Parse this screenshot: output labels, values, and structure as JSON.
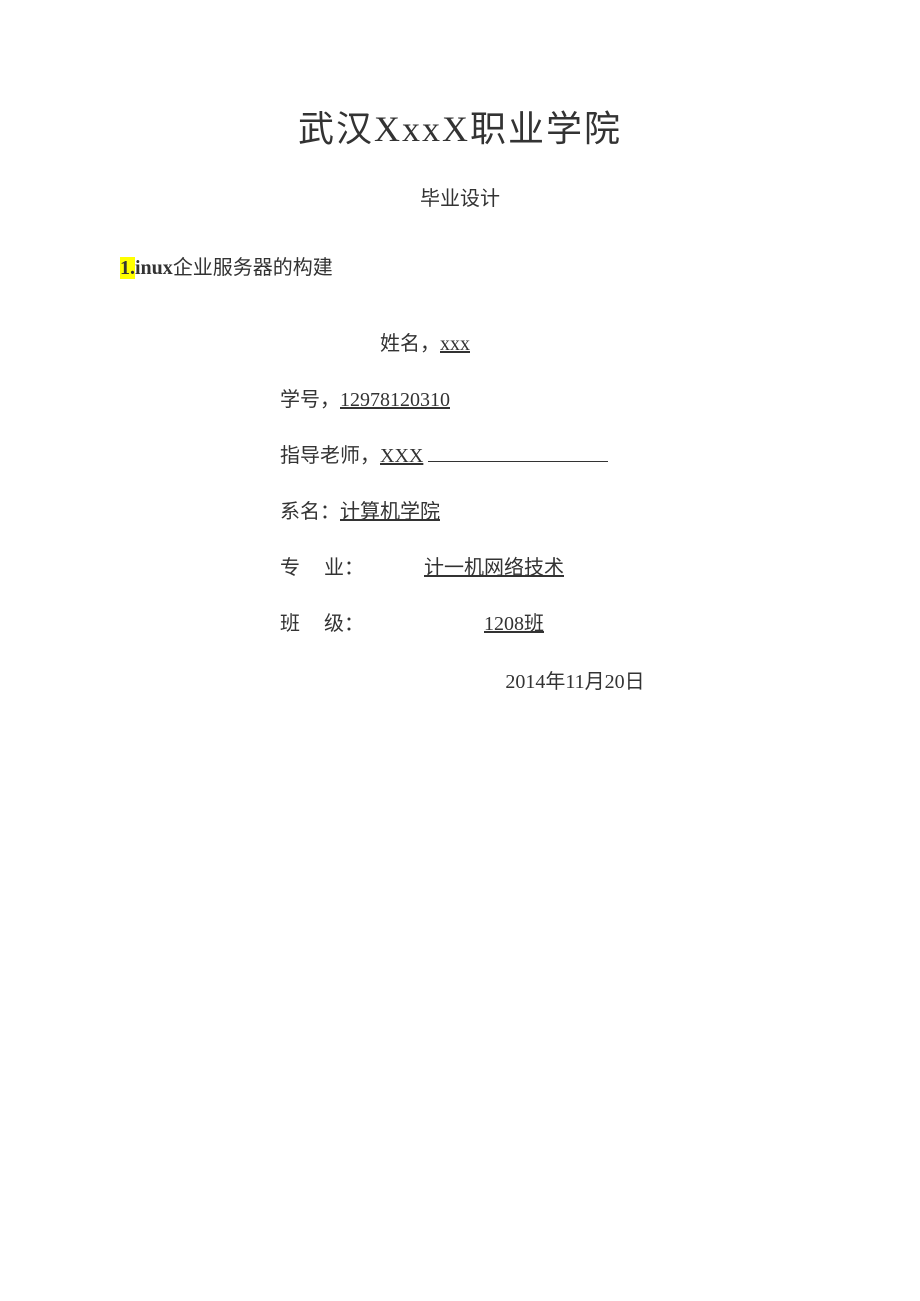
{
  "title": "武汉XxxX职业学院",
  "subtitle": "毕业设计",
  "topic": {
    "highlight": "1.",
    "bold": "inux",
    "rest": "企业服务器的构建"
  },
  "name": {
    "label": "姓名，",
    "value": "xxx"
  },
  "student_id": {
    "label": "学号，",
    "value": "12978120310"
  },
  "advisor": {
    "label": "指导老师，",
    "value": "XXX"
  },
  "department": {
    "label": "系名：",
    "value": "计算机学院"
  },
  "major": {
    "label_char1": "专",
    "label_char2": "业：",
    "value": "计一机网络技术"
  },
  "class": {
    "label_char1": "班",
    "label_char2": "级：",
    "value": "1208班"
  },
  "date": "2014年11月20日"
}
